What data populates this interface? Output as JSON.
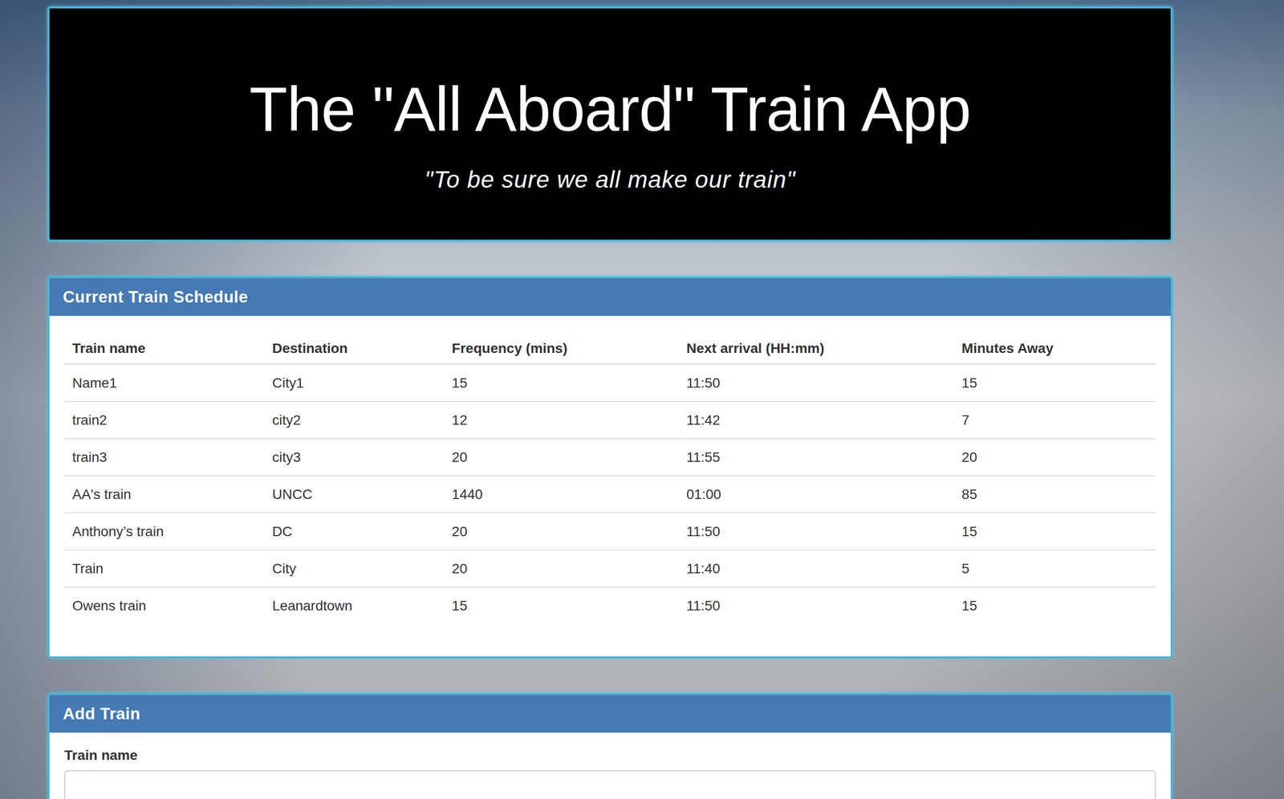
{
  "header": {
    "title": "The \"All Aboard\" Train App",
    "subtitle": "\"To be sure we all make our train\""
  },
  "schedule": {
    "title": "Current Train Schedule",
    "columns": [
      "Train name",
      "Destination",
      "Frequency (mins)",
      "Next arrival (HH:mm)",
      "Minutes Away"
    ],
    "rows": [
      [
        "Name1",
        "City1",
        "15",
        "11:50",
        "15"
      ],
      [
        "train2",
        "city2",
        "12",
        "11:42",
        "7"
      ],
      [
        "train3",
        "city3",
        "20",
        "11:55",
        "20"
      ],
      [
        "AA's train",
        "UNCC",
        "1440",
        "01:00",
        "85"
      ],
      [
        "Anthony’s train",
        "DC",
        "20",
        "11:50",
        "15"
      ],
      [
        "Train",
        "City",
        "20",
        "11:40",
        "5"
      ],
      [
        "Owens train",
        "Leanardtown",
        "15",
        "11:50",
        "15"
      ]
    ]
  },
  "add_train": {
    "title": "Add Train",
    "fields": [
      {
        "label": "Train name",
        "value": ""
      }
    ]
  }
}
